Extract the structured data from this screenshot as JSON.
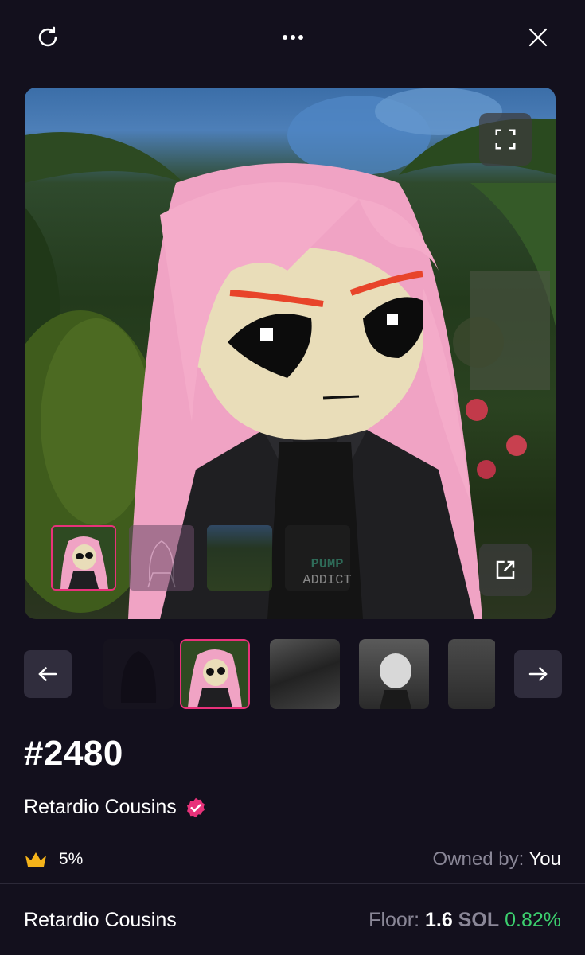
{
  "nft": {
    "id_label": "#2480",
    "collection_name": "Retardio Cousins",
    "rarity": "5%",
    "owned_label": "Owned by:",
    "owner": "You"
  },
  "footer": {
    "collection_name": "Retardio Cousins",
    "floor_label": "Floor:",
    "floor_value": "1.6",
    "floor_unit": "SOL",
    "floor_change": "0.82%"
  },
  "hero_overlay": {
    "shirt_text_1": "PUMP",
    "shirt_text_2": "ADDICT"
  },
  "colors": {
    "background": "#13101d",
    "accent": "#e8327a",
    "positive": "#3ccf6e",
    "muted": "#8a8797"
  },
  "icons": [
    "refresh-icon",
    "more-icon",
    "close-icon",
    "expand-icon",
    "external-link-icon",
    "arrow-left-icon",
    "arrow-right-icon",
    "verified-icon",
    "crown-icon"
  ]
}
